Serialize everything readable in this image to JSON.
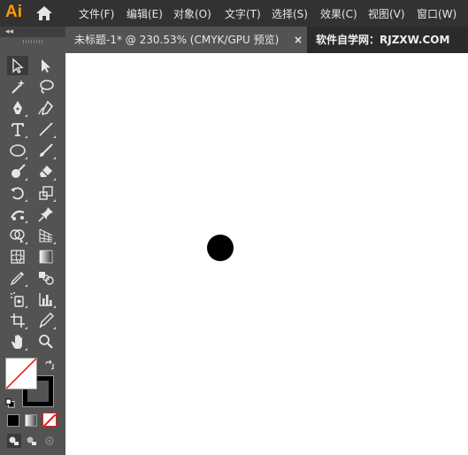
{
  "app": {
    "logo": "Ai"
  },
  "menu": {
    "items": [
      "文件(F)",
      "编辑(E)",
      "对象(O)",
      "文字(T)",
      "选择(S)",
      "效果(C)",
      "视图(V)",
      "窗口(W)"
    ]
  },
  "tabs": {
    "document": "未标题-1* @ 230.53% (CMYK/GPU 预览)",
    "close": "×",
    "site": "软件自学网：RJZXW.COM"
  },
  "toolbar": {
    "collapse": "◂◂",
    "tools": [
      "selection-tool",
      "direct-selection-tool",
      "magic-wand-tool",
      "lasso-tool",
      "pen-tool",
      "curvature-tool",
      "type-tool",
      "line-segment-tool",
      "ellipse-tool",
      "paintbrush-tool",
      "shaper-tool",
      "eraser-tool",
      "rotate-tool",
      "scale-tool",
      "puppet-warp-tool",
      "pin-tool",
      "shape-builder-tool",
      "perspective-grid-tool",
      "mesh-tool",
      "gradient-tool",
      "eyedropper-tool",
      "blend-tool",
      "symbol-sprayer-tool",
      "column-graph-tool",
      "artboard-tool",
      "slice-tool",
      "hand-tool",
      "zoom-tool"
    ],
    "fill_color": "#ffffff",
    "stroke_color": "#000000"
  },
  "canvas": {
    "background": "#ffffff",
    "shape": {
      "type": "circle",
      "color": "#000000"
    }
  }
}
